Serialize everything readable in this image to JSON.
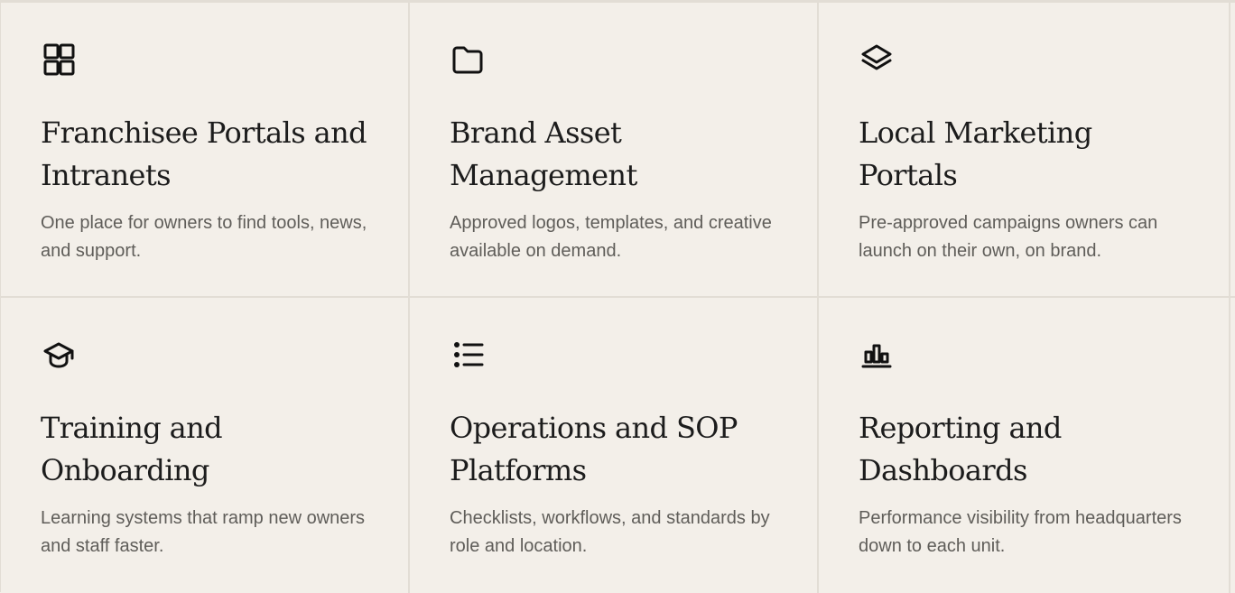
{
  "features": [
    {
      "icon": "grid-icon",
      "title": "Franchisee Portals and Intranets",
      "description": "One place for owners to find tools, news, and support."
    },
    {
      "icon": "folder-icon",
      "title": "Brand Asset Management",
      "description": "Approved logos, templates, and creative available on demand."
    },
    {
      "icon": "layers-icon",
      "title": "Local Marketing Portals",
      "description": "Pre-approved campaigns owners can launch on their own, on brand."
    },
    {
      "icon": "graduation-cap-icon",
      "title": "Training and Onboarding",
      "description": "Learning systems that ramp new owners and staff faster."
    },
    {
      "icon": "list-icon",
      "title": "Operations and SOP Platforms",
      "description": "Checklists, workflows, and standards by role and location."
    },
    {
      "icon": "bar-chart-icon",
      "title": "Reporting and Dashboards",
      "description": "Performance visibility from headquarters down to each unit."
    }
  ]
}
